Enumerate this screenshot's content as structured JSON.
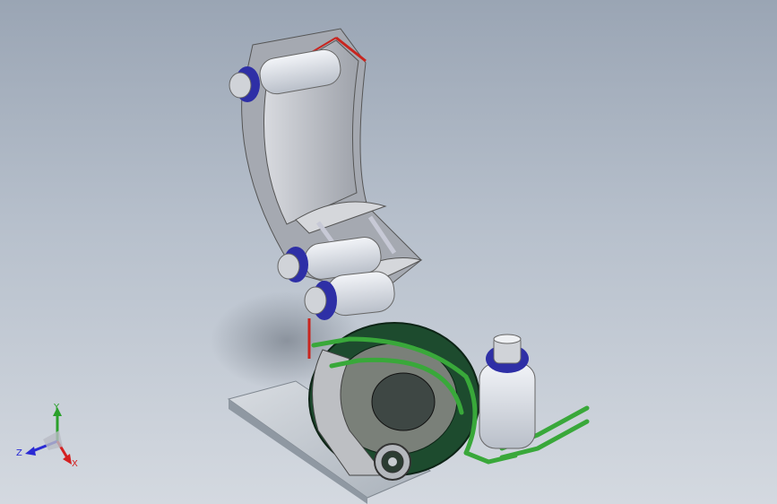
{
  "viewport": {
    "background_top": "#9aa5b4",
    "background_bottom": "#d4d9e0"
  },
  "model": {
    "part_colors": {
      "chute_gray": "#c9cbd0",
      "chute_edge": "#c8251f",
      "bottle_white": "#e7eaf0",
      "cap_blue": "#2e2fa6",
      "wheel_green": "#1d4b2e",
      "tube_green": "#39a83a",
      "base_plate": "#c5ccd2"
    }
  },
  "triad": {
    "x_label": "X",
    "y_label": "Y",
    "z_label": "Z",
    "x_color": "#d42020",
    "y_color": "#2aa02a",
    "z_color": "#2a2ad4"
  }
}
